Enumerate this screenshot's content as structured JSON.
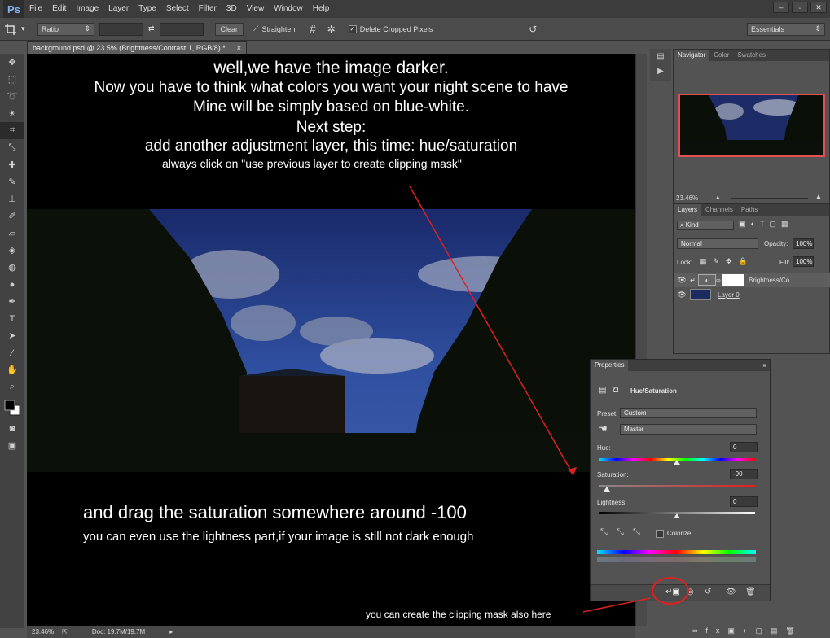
{
  "app": {
    "logo": "Ps"
  },
  "menu": [
    "File",
    "Edit",
    "Image",
    "Layer",
    "Type",
    "Select",
    "Filter",
    "3D",
    "View",
    "Window",
    "Help"
  ],
  "window_controls": [
    "–",
    "▫",
    "✕"
  ],
  "options": {
    "ratio": "Ratio",
    "clear": "Clear",
    "straighten": "Straighten",
    "delete_cropped": "Delete Cropped Pixels",
    "workspace": "Essentials"
  },
  "document": {
    "tab_title": "background.psd @ 23.5% (Brightness/Contrast 1, RGB/8) *",
    "close": "×",
    "zoom": "23.46%",
    "doc_info": "Doc: 19.7M/19.7M"
  },
  "captions": {
    "line1": "well,we have the image darker.",
    "line2": "Now you have to think what colors  you want your night scene to have",
    "line3": "Mine will be simply  based on blue-white.",
    "line4": "Next step:",
    "line5": "add another adjustment layer, this time: hue/saturation",
    "line6": "always click on \"use previous layer to create clipping mask\"",
    "line7": "and drag the saturation  somewhere around -100",
    "line8": "you can even use the lightness part,if your image is still not dark enough",
    "clip_note": "you can create the clipping mask also here"
  },
  "navigator": {
    "tabs": [
      "Navigator",
      "Color",
      "Swatches"
    ],
    "zoom": "23.46%"
  },
  "layers": {
    "tabs": [
      "Layers",
      "Channels",
      "Paths"
    ],
    "kind": "Kind",
    "blend": "Normal",
    "opacity_label": "Opacity:",
    "opacity": "100%",
    "lock_label": "Lock:",
    "fill_label": "Fill:",
    "fill": "100%",
    "items": [
      {
        "name": "Brightness/Co..."
      },
      {
        "name": "Layer 0"
      }
    ]
  },
  "properties": {
    "tab": "Properties",
    "title": "Hue/Saturation",
    "preset_label": "Preset:",
    "preset": "Custom",
    "channel": "Master",
    "hue_label": "Hue:",
    "hue": "0",
    "sat_label": "Saturation:",
    "saturation": "-90",
    "light_label": "Lightness:",
    "lightness": "0",
    "colorize": "Colorize",
    "levels": {
      "hue": 0,
      "saturation": -90,
      "lightness": 0
    }
  },
  "colors": {
    "accent_red": "#e02020",
    "nav_border": "#e05050"
  }
}
